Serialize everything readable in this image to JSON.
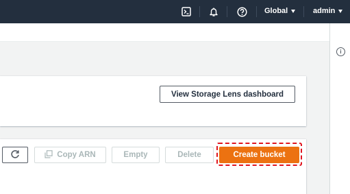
{
  "topnav": {
    "icons": [
      "cloudshell-icon",
      "bell-icon",
      "help-icon"
    ],
    "region_label": "Global",
    "user_label": "admin"
  },
  "storage_lens": {
    "view_dashboard_label": "View Storage Lens dashboard"
  },
  "buckets_toolbar": {
    "refresh_icon": "refresh-icon",
    "copy_icon": "copy-icon",
    "copy_arn_label": "Copy ARN",
    "empty_label": "Empty",
    "delete_label": "Delete",
    "create_bucket_label": "Create bucket"
  },
  "rightrail": {
    "info_icon": "info-icon",
    "info_glyph": "i"
  },
  "colors": {
    "nav_bg": "#232f3e",
    "primary": "#ec7211",
    "highlight": "#e0141e",
    "disabled_text": "#aab7b8"
  }
}
